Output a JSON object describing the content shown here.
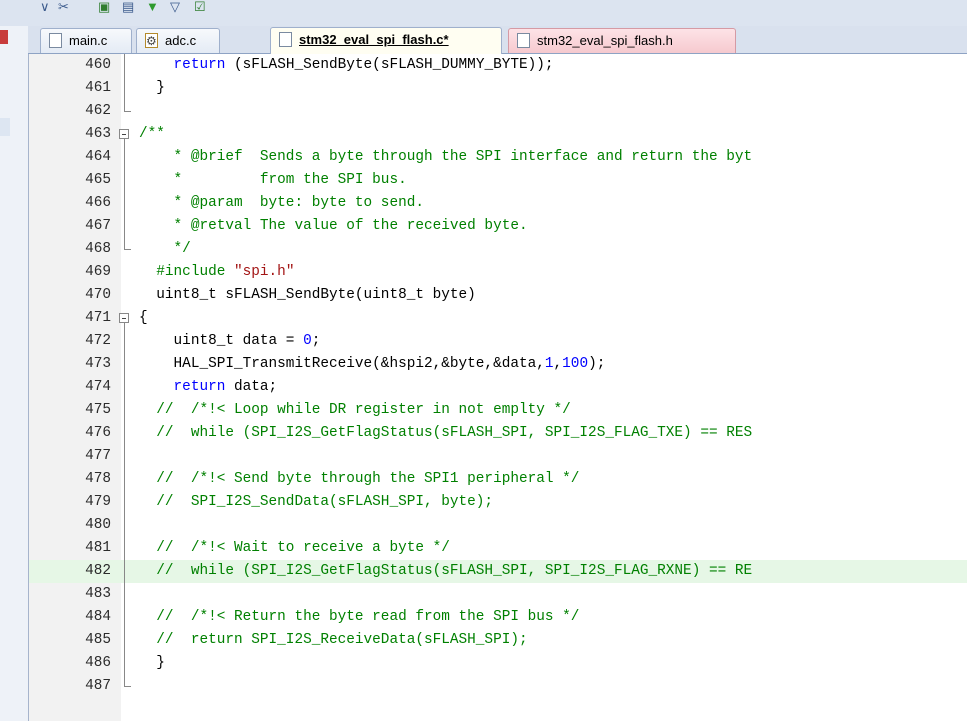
{
  "tabs": [
    {
      "label": "main.c",
      "icon": "file-icon"
    },
    {
      "label": "adc.c",
      "icon": "gear-file-icon"
    },
    {
      "label": "stm32_eval_spi_flash.c*",
      "icon": "file-icon",
      "active": true
    },
    {
      "label": "stm32_eval_spi_flash.h",
      "icon": "file-icon"
    }
  ],
  "colors": {
    "keyword": "#0000ff",
    "comment": "#008000",
    "string": "#a31515",
    "highlight": "#e6f7e6"
  },
  "lines": [
    {
      "n": "460",
      "fold": "bar",
      "parts": [
        [
          "",
          "    "
        ],
        [
          "kw",
          "return"
        ],
        [
          "",
          " (sFLASH_SendByte(sFLASH_DUMMY_BYTE));"
        ]
      ]
    },
    {
      "n": "461",
      "fold": "bar",
      "parts": [
        [
          "",
          "  }"
        ]
      ]
    },
    {
      "n": "462",
      "fold": "end",
      "parts": []
    },
    {
      "n": "463",
      "fold": "box",
      "parts": [
        [
          "cm",
          "/**"
        ]
      ]
    },
    {
      "n": "464",
      "fold": "bar",
      "parts": [
        [
          "cm",
          "    * @brief  Sends a byte through the SPI interface and return the byt"
        ]
      ]
    },
    {
      "n": "465",
      "fold": "bar",
      "parts": [
        [
          "cm",
          "    *         from the SPI bus."
        ]
      ]
    },
    {
      "n": "466",
      "fold": "bar",
      "parts": [
        [
          "cm",
          "    * @param  byte: byte to send."
        ]
      ]
    },
    {
      "n": "467",
      "fold": "bar",
      "parts": [
        [
          "cm",
          "    * @retval The value of the received byte."
        ]
      ]
    },
    {
      "n": "468",
      "fold": "end",
      "parts": [
        [
          "cm",
          "    */"
        ]
      ]
    },
    {
      "n": "469",
      "fold": "",
      "parts": [
        [
          "pp",
          "  #include "
        ],
        [
          "str",
          "\"spi.h\""
        ]
      ]
    },
    {
      "n": "470",
      "fold": "",
      "parts": [
        [
          "",
          "  uint8_t sFLASH_SendByte(uint8_t byte)"
        ]
      ]
    },
    {
      "n": "471",
      "fold": "box",
      "parts": [
        [
          "",
          "{"
        ]
      ]
    },
    {
      "n": "472",
      "fold": "bar",
      "parts": [
        [
          "",
          "    uint8_t data = "
        ],
        [
          "num",
          "0"
        ],
        [
          "",
          ";"
        ]
      ]
    },
    {
      "n": "473",
      "fold": "bar",
      "parts": [
        [
          "",
          "    HAL_SPI_TransmitReceive(&hspi2,&byte,&data,"
        ],
        [
          "num",
          "1"
        ],
        [
          "",
          ","
        ],
        [
          "num",
          "100"
        ],
        [
          "",
          ");"
        ]
      ]
    },
    {
      "n": "474",
      "fold": "bar",
      "parts": [
        [
          "",
          "    "
        ],
        [
          "kw",
          "return"
        ],
        [
          "",
          " data;"
        ]
      ]
    },
    {
      "n": "475",
      "fold": "bar",
      "parts": [
        [
          "cm",
          "  //  /*!< Loop while DR register in not emplty */"
        ]
      ]
    },
    {
      "n": "476",
      "fold": "bar",
      "parts": [
        [
          "cm",
          "  //  while (SPI_I2S_GetFlagStatus(sFLASH_SPI, SPI_I2S_FLAG_TXE) == RES"
        ]
      ]
    },
    {
      "n": "477",
      "fold": "bar",
      "parts": []
    },
    {
      "n": "478",
      "fold": "bar",
      "parts": [
        [
          "cm",
          "  //  /*!< Send byte through the SPI1 peripheral */"
        ]
      ]
    },
    {
      "n": "479",
      "fold": "bar",
      "parts": [
        [
          "cm",
          "  //  SPI_I2S_SendData(sFLASH_SPI, byte);"
        ]
      ]
    },
    {
      "n": "480",
      "fold": "bar",
      "parts": []
    },
    {
      "n": "481",
      "fold": "bar",
      "parts": [
        [
          "cm",
          "  //  /*!< Wait to receive a byte */"
        ]
      ]
    },
    {
      "n": "482",
      "fold": "bar",
      "hl": true,
      "parts": [
        [
          "cm",
          "  //  while (SPI_I2S_GetFlagStatus(sFLASH_SPI, SPI_I2S_FLAG_RXNE) == RE"
        ]
      ]
    },
    {
      "n": "483",
      "fold": "bar",
      "parts": []
    },
    {
      "n": "484",
      "fold": "bar",
      "parts": [
        [
          "cm",
          "  //  /*!< Return the byte read from the SPI bus */"
        ]
      ]
    },
    {
      "n": "485",
      "fold": "bar",
      "parts": [
        [
          "cm",
          "  //  return SPI_I2S_ReceiveData(sFLASH_SPI);"
        ]
      ]
    },
    {
      "n": "486",
      "fold": "bar",
      "parts": [
        [
          "",
          "  }"
        ]
      ]
    },
    {
      "n": "487",
      "fold": "end",
      "parts": []
    }
  ]
}
